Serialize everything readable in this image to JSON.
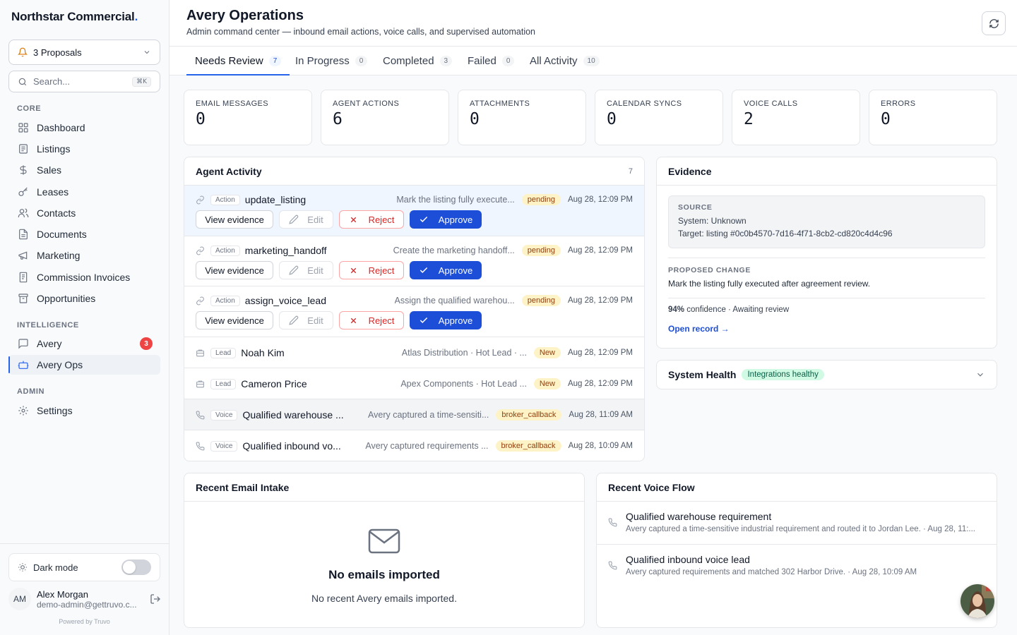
{
  "brand": {
    "name": "Northstar Commercial",
    "dot": "."
  },
  "proposals": {
    "label": "3 Proposals"
  },
  "search": {
    "placeholder": "Search...",
    "shortcut": "⌘K"
  },
  "sidebar": {
    "core_label": "CORE",
    "core_items": [
      {
        "label": "Dashboard",
        "icon": "grid-icon"
      },
      {
        "label": "Listings",
        "icon": "list-icon"
      },
      {
        "label": "Sales",
        "icon": "dollar-icon"
      },
      {
        "label": "Leases",
        "icon": "key-icon"
      },
      {
        "label": "Contacts",
        "icon": "users-icon"
      },
      {
        "label": "Documents",
        "icon": "file-icon"
      },
      {
        "label": "Marketing",
        "icon": "megaphone-icon"
      },
      {
        "label": "Commission Invoices",
        "icon": "receipt-icon"
      },
      {
        "label": "Opportunities",
        "icon": "archive-icon"
      }
    ],
    "intelligence_label": "INTELLIGENCE",
    "intelligence_items": [
      {
        "label": "Avery",
        "icon": "chat-icon",
        "badge": "3"
      },
      {
        "label": "Avery Ops",
        "icon": "bot-icon",
        "active": true
      }
    ],
    "admin_label": "ADMIN",
    "admin_items": [
      {
        "label": "Settings",
        "icon": "gear-icon"
      }
    ],
    "dark_mode_label": "Dark mode",
    "dark_mode_on": false,
    "user": {
      "initials": "AM",
      "name": "Alex Morgan",
      "email": "demo-admin@gettruvo.c..."
    },
    "powered_by": "Powered by  Truvo"
  },
  "header": {
    "title": "Avery Operations",
    "subtitle": "Admin command center — inbound email actions, voice calls, and supervised automation"
  },
  "tabs": [
    {
      "label": "Needs Review",
      "count": "7",
      "active": true
    },
    {
      "label": "In Progress",
      "count": "0"
    },
    {
      "label": "Completed",
      "count": "3"
    },
    {
      "label": "Failed",
      "count": "0"
    },
    {
      "label": "All Activity",
      "count": "10"
    }
  ],
  "stats": [
    {
      "label": "EMAIL MESSAGES",
      "value": "0"
    },
    {
      "label": "AGENT ACTIONS",
      "value": "6"
    },
    {
      "label": "ATTACHMENTS",
      "value": "0"
    },
    {
      "label": "CALENDAR SYNCS",
      "value": "0"
    },
    {
      "label": "VOICE CALLS",
      "value": "2"
    },
    {
      "label": "ERRORS",
      "value": "0"
    }
  ],
  "agent_activity": {
    "title": "Agent Activity",
    "count": "7",
    "buttons": {
      "view": "View evidence",
      "edit": "Edit",
      "reject": "Reject",
      "approve": "Approve"
    },
    "rows": [
      {
        "kind": "Action",
        "title": "update_listing",
        "desc": "Mark the listing fully execute...",
        "status": "pending",
        "time": "Aug 28, 12:09 PM"
      },
      {
        "kind": "Action",
        "title": "marketing_handoff",
        "desc": "Create the marketing handoff...",
        "status": "pending",
        "time": "Aug 28, 12:09 PM"
      },
      {
        "kind": "Action",
        "title": "assign_voice_lead",
        "desc": "Assign the qualified warehou...",
        "status": "pending",
        "time": "Aug 28, 12:09 PM"
      },
      {
        "kind": "Lead",
        "title": "Noah Kim",
        "desc": "Atlas Distribution · Hot Lead · ...",
        "status": "New",
        "time": "Aug 28, 12:09 PM"
      },
      {
        "kind": "Lead",
        "title": "Cameron Price",
        "desc": "Apex Components · Hot Lead ...",
        "status": "New",
        "time": "Aug 28, 12:09 PM"
      },
      {
        "kind": "Voice",
        "title": "Qualified warehouse ...",
        "desc": "Avery captured a time-sensiti...",
        "status": "broker_callback",
        "time": "Aug 28, 11:09 AM"
      },
      {
        "kind": "Voice",
        "title": "Qualified inbound vo...",
        "desc": "Avery captured requirements ...",
        "status": "broker_callback",
        "time": "Aug 28, 10:09 AM"
      }
    ]
  },
  "evidence": {
    "title": "Evidence",
    "source_label": "SOURCE",
    "system": "System: Unknown",
    "target": "Target: listing #0c0b4570-7d16-4f71-8cb2-cd820c4d4c96",
    "proposed_label": "PROPOSED CHANGE",
    "proposed_text": "Mark the listing fully executed after agreement review.",
    "confidence": "94%",
    "confidence_rest": " confidence · Awaiting review",
    "open_record": "Open record →"
  },
  "system_health": {
    "title": "System Health",
    "status": "Integrations healthy"
  },
  "email_intake": {
    "title": "Recent Email Intake",
    "empty_title": "No emails imported",
    "empty_text": "No recent Avery emails imported."
  },
  "voice_flow": {
    "title": "Recent Voice Flow",
    "items": [
      {
        "title": "Qualified warehouse requirement",
        "desc": "Avery captured a time-sensitive industrial requirement and routed it to Jordan Lee. · Aug 28, 11:..."
      },
      {
        "title": "Qualified inbound voice lead",
        "desc": "Avery captured requirements and matched 302 Harbor Drive. · Aug 28, 10:09 AM"
      }
    ]
  },
  "colors": {
    "accent": "#2563eb",
    "approve": "#1d4ed8",
    "reject": "#dc2626",
    "pending_bg": "#fef3c7",
    "healthy_bg": "#d1fae5"
  }
}
